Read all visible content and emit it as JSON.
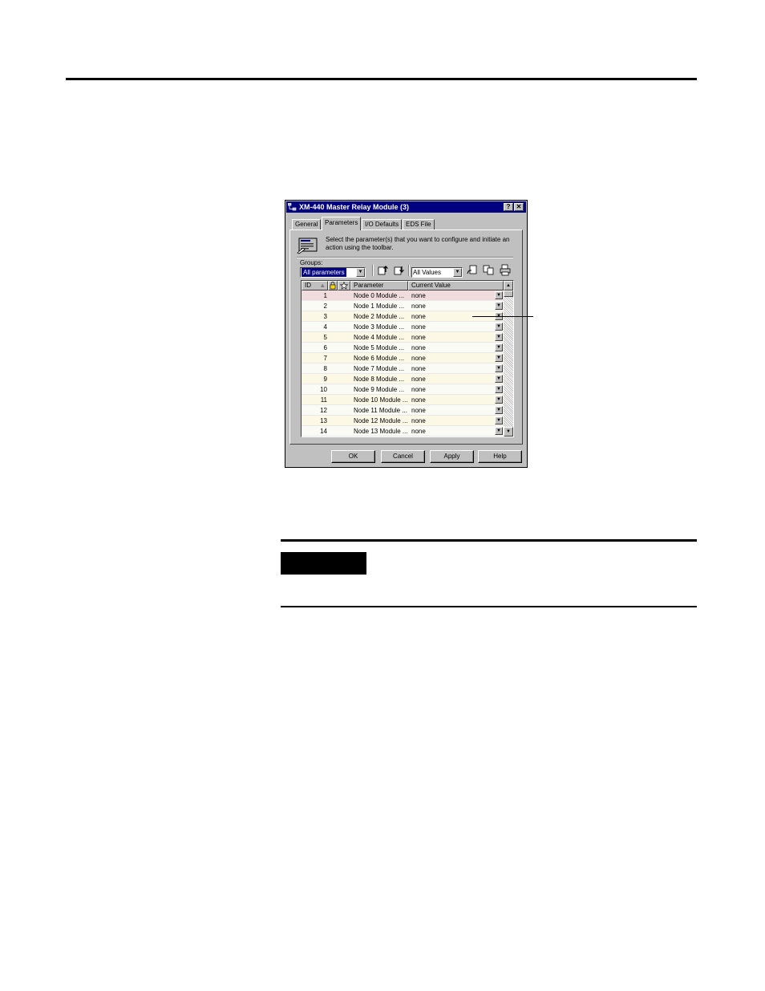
{
  "dialog": {
    "title": "XM-440 Master Relay Module (3)",
    "help_btn": "?",
    "close_btn": "✕",
    "tabs": [
      {
        "label": "General"
      },
      {
        "label": "Parameters"
      },
      {
        "label": "I/O Defaults"
      },
      {
        "label": "EDS File"
      }
    ],
    "active_tab": "Parameters",
    "instructions": "Select the parameter(s) that you want to configure and initiate an action using the toolbar.",
    "groups_label": "Groups:",
    "groups_value": "All parameters",
    "values_filter": "All Values",
    "columns": {
      "id": "ID",
      "parameter": "Parameter",
      "current_value": "Current Value"
    },
    "rows": [
      {
        "id": "1",
        "parameter": "Node 0 Module ...",
        "value": "none"
      },
      {
        "id": "2",
        "parameter": "Node 1 Module ...",
        "value": "none"
      },
      {
        "id": "3",
        "parameter": "Node 2 Module ...",
        "value": "none"
      },
      {
        "id": "4",
        "parameter": "Node 3 Module ...",
        "value": "none"
      },
      {
        "id": "5",
        "parameter": "Node 4 Module ...",
        "value": "none"
      },
      {
        "id": "6",
        "parameter": "Node 5 Module ...",
        "value": "none"
      },
      {
        "id": "7",
        "parameter": "Node 6 Module ...",
        "value": "none"
      },
      {
        "id": "8",
        "parameter": "Node 7 Module ...",
        "value": "none"
      },
      {
        "id": "9",
        "parameter": "Node 8 Module ...",
        "value": "none"
      },
      {
        "id": "10",
        "parameter": "Node 9 Module ...",
        "value": "none"
      },
      {
        "id": "11",
        "parameter": "Node 10 Module ...",
        "value": "none"
      },
      {
        "id": "12",
        "parameter": "Node 11 Module ...",
        "value": "none"
      },
      {
        "id": "13",
        "parameter": "Node 12 Module ...",
        "value": "none"
      },
      {
        "id": "14",
        "parameter": "Node 13 Module ...",
        "value": "none"
      }
    ],
    "buttons": {
      "ok": "OK",
      "cancel": "Cancel",
      "apply": "Apply",
      "help": "Help"
    }
  },
  "colors": {
    "titlebar": "#000080",
    "face": "#c0c0c0",
    "row_selected": "#f0dcdc",
    "row_alt": "#fbf8e6"
  }
}
